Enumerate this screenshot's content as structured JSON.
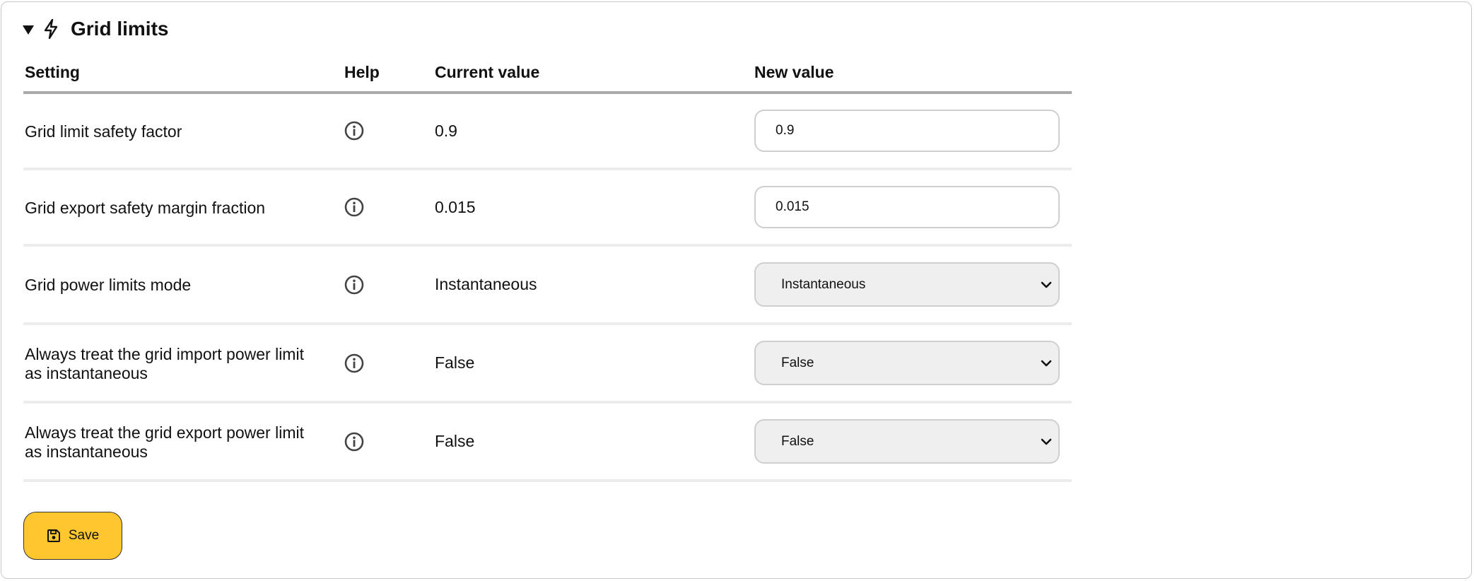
{
  "section": {
    "title": "Grid limits",
    "expanded": true,
    "icon": "lightning-bolt-icon"
  },
  "table": {
    "headers": {
      "setting": "Setting",
      "help": "Help",
      "current": "Current value",
      "new": "New value"
    },
    "rows": [
      {
        "setting": "Grid limit safety factor",
        "help_icon": "info-circle-icon",
        "current": "0.9",
        "control": "input",
        "new_value": "0.9"
      },
      {
        "setting": "Grid export safety margin fraction",
        "help_icon": "info-circle-icon",
        "current": "0.015",
        "control": "input",
        "new_value": "0.015"
      },
      {
        "setting": "Grid power limits mode",
        "help_icon": "info-circle-icon",
        "current": "Instantaneous",
        "control": "select",
        "new_value": "Instantaneous"
      },
      {
        "setting": "Always treat the grid import power limit as instantaneous",
        "help_icon": "info-circle-icon",
        "current": "False",
        "control": "select",
        "new_value": "False"
      },
      {
        "setting": "Always treat the grid export power limit as instantaneous",
        "help_icon": "info-circle-icon",
        "current": "False",
        "control": "select",
        "new_value": "False"
      }
    ]
  },
  "save_button": {
    "label": "Save",
    "icon": "floppy-disk-icon",
    "color": "#ffc62e"
  }
}
